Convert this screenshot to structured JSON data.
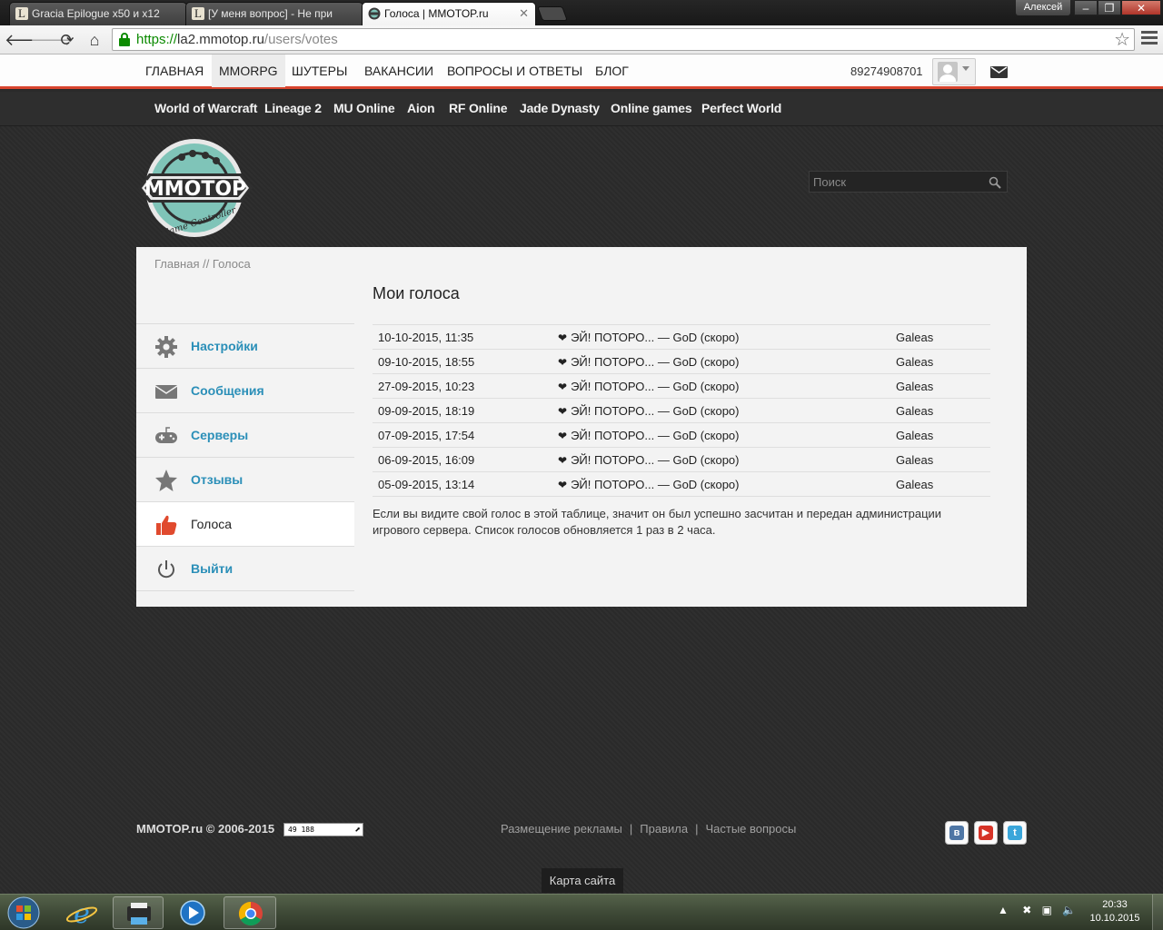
{
  "browser": {
    "tabs": [
      {
        "title": "Gracia Epilogue x50 и x12",
        "favicon": "L"
      },
      {
        "title": "[У меня вопрос] - Не при",
        "favicon": "L"
      },
      {
        "title": "Голоса | MMOTOP.ru",
        "favicon": "mmotop"
      }
    ],
    "window_user": "Алексей",
    "url_scheme": "https://",
    "url_host": "la2.mmotop.ru",
    "url_path": "/users/votes"
  },
  "site": {
    "nav": [
      "ГЛАВНАЯ",
      "MMORPG",
      "ШУТЕРЫ",
      "ВАКАНСИИ",
      "ВОПРОСЫ И ОТВЕТЫ",
      "БЛОГ"
    ],
    "nav_active": "MMORPG",
    "phone": "89274908701",
    "games": [
      "World of Warcraft",
      "Lineage 2",
      "MU Online",
      "Aion",
      "RF Online",
      "Jade Dynasty",
      "Online games",
      "Perfect World"
    ],
    "logo_text": "MMOTOP",
    "logo_sub": "Game Controller",
    "search_placeholder": "Поиск",
    "accent": "#d9452f",
    "link_color": "#2b8fb8"
  },
  "panel": {
    "breadcrumb": "Главная // Голоса",
    "menu": [
      {
        "label": "Настройки",
        "icon": "gear-icon"
      },
      {
        "label": "Сообщения",
        "icon": "envelope-icon"
      },
      {
        "label": "Серверы",
        "icon": "gamepad-icon"
      },
      {
        "label": "Отзывы",
        "icon": "star-icon"
      },
      {
        "label": "Голоса",
        "icon": "thumbs-up-icon",
        "active": true
      },
      {
        "label": "Выйти",
        "icon": "power-icon"
      }
    ],
    "title": "Мои голоса",
    "votes": [
      {
        "date": "10-10-2015, 11:35",
        "server": "ЭЙ! ПОТОРО... — GoD (скоро)",
        "name": "Galeas"
      },
      {
        "date": "09-10-2015, 18:55",
        "server": "ЭЙ! ПОТОРО... — GoD (скоро)",
        "name": "Galeas"
      },
      {
        "date": "27-09-2015, 10:23",
        "server": "ЭЙ! ПОТОРО... — GoD (скоро)",
        "name": "Galeas"
      },
      {
        "date": "09-09-2015, 18:19",
        "server": "ЭЙ! ПОТОРО... — GoD (скоро)",
        "name": "Galeas"
      },
      {
        "date": "07-09-2015, 17:54",
        "server": "ЭЙ! ПОТОРО... — GoD (скоро)",
        "name": "Galeas"
      },
      {
        "date": "06-09-2015, 16:09",
        "server": "ЭЙ! ПОТОРО... — GoD (скоро)",
        "name": "Galeas"
      },
      {
        "date": "05-09-2015, 13:14",
        "server": "ЭЙ! ПОТОРО... — GoD (скоро)",
        "name": "Galeas"
      }
    ],
    "note": "Если вы видите свой голос в этой таблице, значит он был успешно засчитан и передан администрации игрового сервера. Список голосов обновляется 1 раз в 2 часа."
  },
  "footer": {
    "copyright": "MMOTOP.ru © 2006-2015",
    "counter": "49 188",
    "links": [
      "Размещение рекламы",
      "Правила",
      "Частые вопросы"
    ],
    "social": [
      "vk-icon",
      "youtube-icon",
      "twitter-icon"
    ],
    "sitemap": "Карта сайта"
  },
  "taskbar": {
    "time": "20:33",
    "date": "10.10.2015"
  }
}
